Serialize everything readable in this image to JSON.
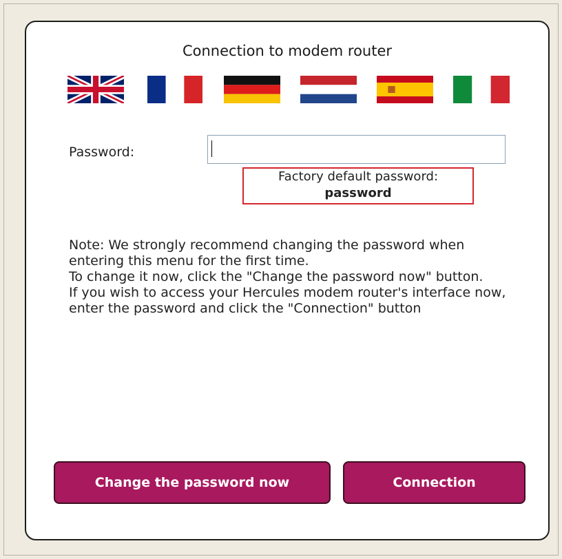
{
  "dialog": {
    "title": "Connection to modem router"
  },
  "languages": [
    {
      "code": "en",
      "icon": "uk-flag-icon"
    },
    {
      "code": "fr",
      "icon": "france-flag-icon"
    },
    {
      "code": "de",
      "icon": "germany-flag-icon"
    },
    {
      "code": "nl",
      "icon": "netherlands-flag-icon"
    },
    {
      "code": "es",
      "icon": "spain-flag-icon"
    },
    {
      "code": "it",
      "icon": "italy-flag-icon"
    }
  ],
  "password_field": {
    "label": "Password:",
    "value": "",
    "placeholder": ""
  },
  "default_hint": {
    "line1": "Factory default password:",
    "password": "password"
  },
  "note": {
    "line1": "Note: We strongly recommend changing the password when entering this menu for the first time.",
    "line2": "To change it now, click the \"Change the password now\" button.",
    "line3": "If you wish to access your Hercules modem router's interface now, enter the password and click the \"Connection\" button"
  },
  "buttons": {
    "change_password": "Change the password now",
    "connection": "Connection"
  },
  "colors": {
    "button_bg": "#a8195e",
    "hint_border": "#d4262b",
    "page_bg": "#efebe1"
  }
}
